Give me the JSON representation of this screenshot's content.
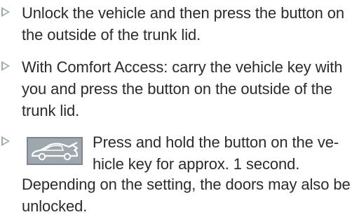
{
  "instructions": [
    {
      "text": "Unlock the vehicle and then press the button on the outside of the trunk lid."
    },
    {
      "text": "With Comfort Access: carry the vehicle key with you and press the button on the outside of the trunk lid."
    },
    {
      "icon": "car-trunk-open-icon",
      "text": "Press and hold the button on the ve-hicle key for approx. 1 second."
    }
  ],
  "note": "Depending on the setting, the doors may also be unlocked."
}
